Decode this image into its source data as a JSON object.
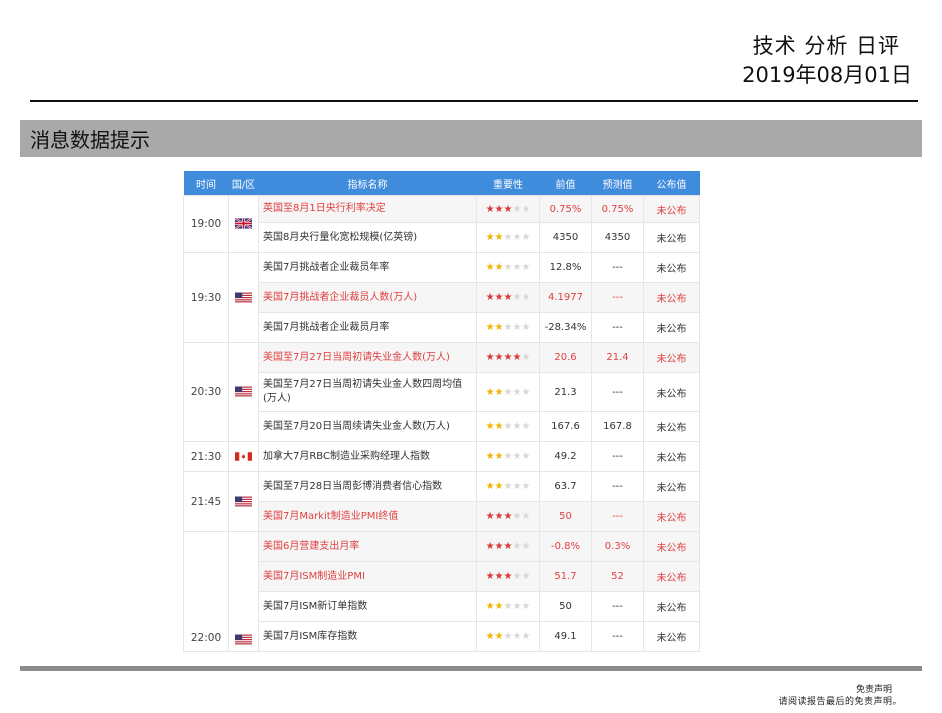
{
  "header": {
    "title": "技术 分析 日评",
    "date": "2019年08月01日"
  },
  "section": {
    "title": "消息数据提示"
  },
  "table": {
    "columns": [
      "时间",
      "国/区",
      "指标名称",
      "重要性",
      "前值",
      "预测值",
      "公布值"
    ],
    "rows": [
      {
        "time": "19:00",
        "flag": "UK",
        "name": "英国至8月1日央行利率决定",
        "stars": 3,
        "prev": "0.75%",
        "forecast": "0.75%",
        "actual": "未公布",
        "highlight": true
      },
      {
        "name": "英国8月央行量化宽松规模(亿英镑)",
        "stars": 2,
        "prev": "4350",
        "forecast": "4350",
        "actual": "未公布",
        "highlight": false
      },
      {
        "time": "19:30",
        "flag": "US",
        "name": "美国7月挑战者企业裁员年率",
        "stars": 2,
        "prev": "12.8%",
        "forecast": "---",
        "actual": "未公布",
        "highlight": false
      },
      {
        "name": "美国7月挑战者企业裁员人数(万人)",
        "stars": 3,
        "prev": "4.1977",
        "forecast": "---",
        "actual": "未公布",
        "highlight": true
      },
      {
        "name": "美国7月挑战者企业裁员月率",
        "stars": 2,
        "prev": "-28.34%",
        "forecast": "---",
        "actual": "未公布",
        "highlight": false
      },
      {
        "time": "20:30",
        "flag": "US",
        "name": "美国至7月27日当周初请失业金人数(万人)",
        "stars": 4,
        "prev": "20.6",
        "forecast": "21.4",
        "actual": "未公布",
        "highlight": true
      },
      {
        "name": "美国至7月27日当周初请失业金人数四周均值(万人)",
        "stars": 2,
        "prev": "21.3",
        "forecast": "---",
        "actual": "未公布",
        "highlight": false
      },
      {
        "name": "美国至7月20日当周续请失业金人数(万人)",
        "stars": 2,
        "prev": "167.6",
        "forecast": "167.8",
        "actual": "未公布",
        "highlight": false
      },
      {
        "time": "21:30",
        "flag": "CA",
        "name": "加拿大7月RBC制造业采购经理人指数",
        "stars": 2,
        "prev": "49.2",
        "forecast": "---",
        "actual": "未公布",
        "highlight": false
      },
      {
        "time": "21:45",
        "flag": "US",
        "name": "美国至7月28日当周彭博消费者信心指数",
        "stars": 2,
        "prev": "63.7",
        "forecast": "---",
        "actual": "未公布",
        "highlight": false
      },
      {
        "name": "美国7月Markit制造业PMI终值",
        "stars": 3,
        "prev": "50",
        "forecast": "---",
        "actual": "未公布",
        "highlight": true
      },
      {
        "time": "22:00",
        "flag": "US",
        "name": "美国6月营建支出月率",
        "stars": 3,
        "prev": "-0.8%",
        "forecast": "0.3%",
        "actual": "未公布",
        "highlight": true
      },
      {
        "name": "美国7月ISM制造业PMI",
        "stars": 3,
        "prev": "51.7",
        "forecast": "52",
        "actual": "未公布",
        "highlight": true
      },
      {
        "name": "美国7月ISM新订单指数",
        "stars": 2,
        "prev": "50",
        "forecast": "---",
        "actual": "未公布",
        "highlight": false
      },
      {
        "name": "美国7月ISM库存指数",
        "stars": 2,
        "prev": "49.1",
        "forecast": "---",
        "actual": "未公布",
        "highlight": false
      }
    ]
  },
  "footer": {
    "disclaimer_title": "免责声明",
    "disclaimer_note": "请阅读报告最后的免责声明。"
  },
  "colors": {
    "header_blue": "#3f8bdc",
    "highlight_red": "#e04040",
    "star_red": "#d93a3a",
    "star_yellow": "#f0b400",
    "section_gray": "#a9a9a9"
  }
}
